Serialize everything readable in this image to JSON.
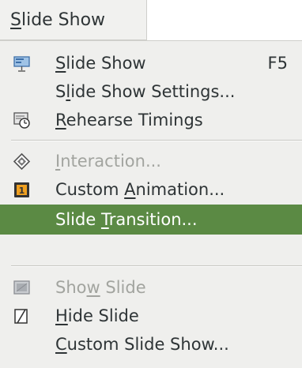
{
  "menu_title": {
    "pre": "",
    "mnemonic": "S",
    "post": "lide Show"
  },
  "items": [
    {
      "pre": "",
      "mnemonic": "S",
      "post": "lide Show",
      "shortcut": "F5",
      "icon": "projector-screen-icon"
    },
    {
      "pre": "S",
      "mnemonic": "l",
      "post": "ide Show Settings..."
    },
    {
      "pre": "",
      "mnemonic": "R",
      "post": "ehearse Timings",
      "icon": "stopwatch-slide-icon"
    },
    {
      "pre": "",
      "mnemonic": "I",
      "post": "nteraction...",
      "icon": "interaction-diamond-icon",
      "state": "disabled"
    },
    {
      "pre": "Custom ",
      "mnemonic": "A",
      "post": "nimation...",
      "icon": "film-frame-icon"
    },
    {
      "pre": "Slide ",
      "mnemonic": "T",
      "post": "ransition...",
      "state": "highlighted"
    },
    {
      "pre": "Sho",
      "mnemonic": "w",
      "post": " Slide",
      "icon": "show-slide-icon",
      "state": "disabled"
    },
    {
      "pre": "",
      "mnemonic": "H",
      "post": "ide Slide",
      "icon": "hide-slide-icon"
    },
    {
      "pre": "",
      "mnemonic": "C",
      "post": "ustom Slide Show..."
    }
  ],
  "colors": {
    "highlight": "#5b8a44",
    "menu_bg": "#efefed",
    "text": "#2e3436",
    "disabled_text": "#a2a49f"
  }
}
